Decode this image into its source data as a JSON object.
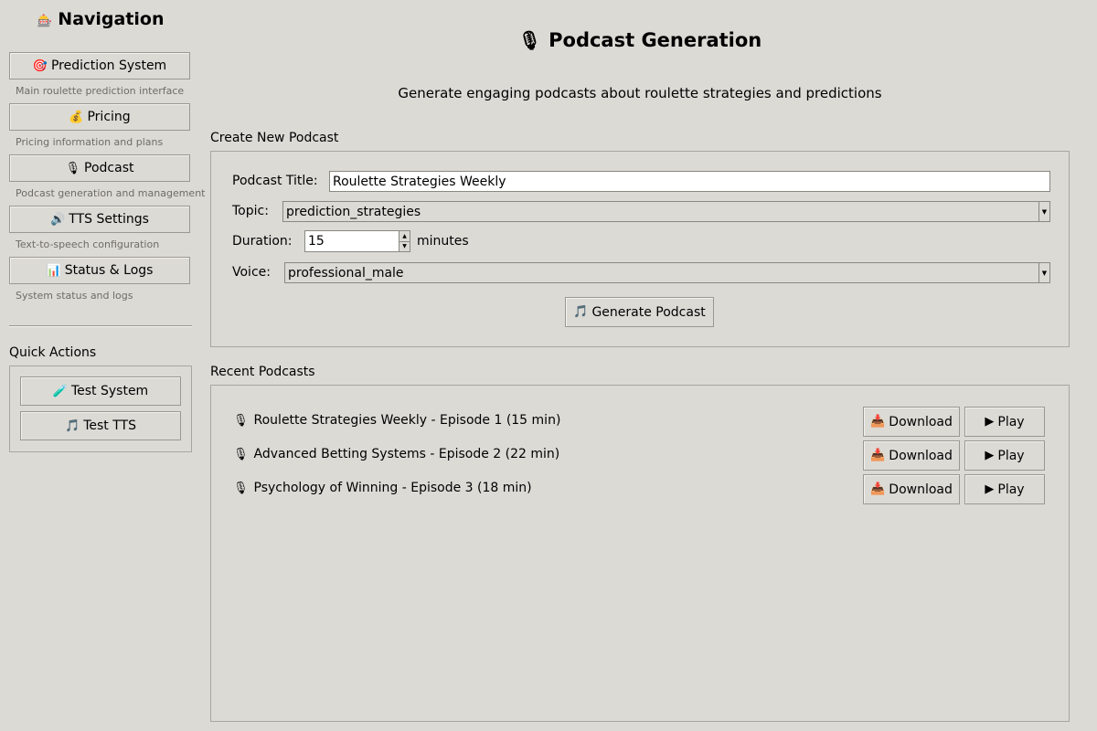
{
  "sidebar": {
    "title_icon": "slot-machine-icon",
    "title_glyph": "🎰",
    "title": "Navigation",
    "items": [
      {
        "icon": "🎯",
        "label": "Prediction System",
        "desc": "Main roulette prediction interface"
      },
      {
        "icon": "💰",
        "label": "Pricing",
        "desc": "Pricing information and plans"
      },
      {
        "icon": "🎙",
        "label": "Podcast",
        "desc": "Podcast generation and management"
      },
      {
        "icon": "🔊",
        "label": "TTS Settings",
        "desc": "Text-to-speech configuration"
      },
      {
        "icon": "📊",
        "label": "Status & Logs",
        "desc": "System status and logs"
      }
    ],
    "quick_actions": {
      "label": "Quick Actions",
      "buttons": [
        {
          "icon": "🧪",
          "label": "Test System"
        },
        {
          "icon": "🎵",
          "label": "Test TTS"
        }
      ]
    }
  },
  "main": {
    "title_icon": "🎙",
    "title": "Podcast Generation",
    "subtitle": "Generate engaging podcasts about roulette strategies and predictions",
    "create": {
      "label": "Create New Podcast",
      "title_label": "Podcast Title:",
      "title_value": "Roulette Strategies Weekly",
      "topic_label": "Topic:",
      "topic_value": "prediction_strategies",
      "duration_label": "Duration:",
      "duration_value": "15",
      "duration_unit": "minutes",
      "voice_label": "Voice:",
      "voice_value": "professional_male",
      "generate_icon": "🎵",
      "generate_label": "Generate Podcast"
    },
    "recent": {
      "label": "Recent Podcasts",
      "download_icon": "📥",
      "download_label": "Download",
      "play_icon": "▶",
      "play_label": "Play",
      "item_icon": "🎙",
      "items": [
        "Roulette Strategies Weekly - Episode 1 (15 min)",
        "Advanced Betting Systems - Episode 2 (22 min)",
        "Psychology of Winning - Episode 3 (18 min)"
      ]
    }
  },
  "colors": {
    "background": "#dcdad5",
    "border": "#a8a6a0",
    "secondary_text": "#6e6c68"
  }
}
